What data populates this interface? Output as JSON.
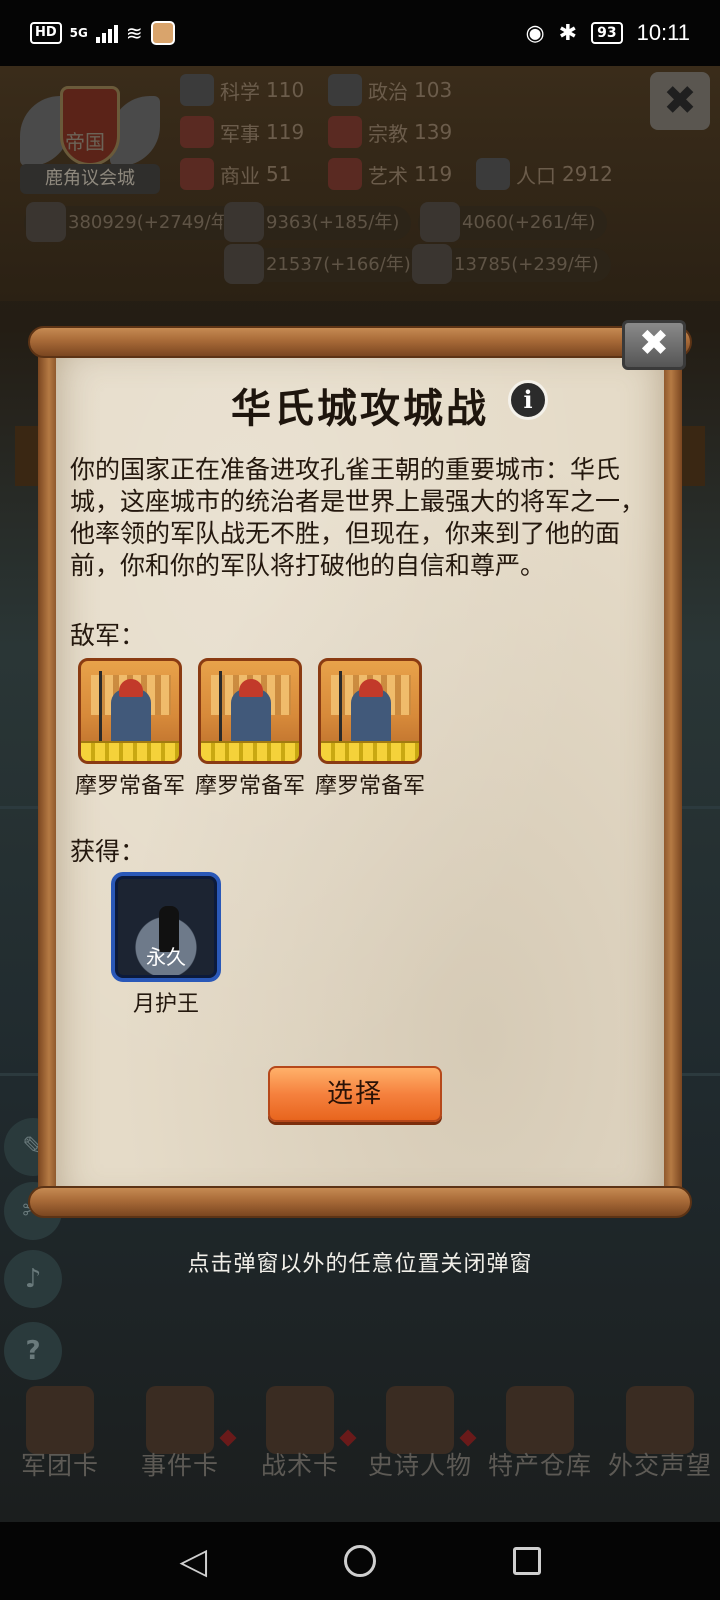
{
  "status_bar": {
    "hd": "HD",
    "network": "5G",
    "battery": "93",
    "time": "10:11"
  },
  "game_background": {
    "emblem": {
      "name": "帝国",
      "banner": "鹿角议会城"
    },
    "stats": [
      {
        "label": "科学",
        "value": "110",
        "icon": "planet-icon"
      },
      {
        "label": "政治",
        "value": "103",
        "icon": "capitol-icon"
      },
      {
        "label": "军事",
        "value": "119",
        "icon": "crossed-swords-icon"
      },
      {
        "label": "宗教",
        "value": "139",
        "icon": "fleur-icon"
      },
      {
        "label": "商业",
        "value": "51",
        "icon": "scales-icon"
      },
      {
        "label": "艺术",
        "value": "119",
        "icon": "lotus-icon"
      },
      {
        "label": "人口",
        "value": "2912",
        "icon": "person-icon"
      }
    ],
    "resources": [
      {
        "value": "380929(+2749/年)",
        "icon": "gold-coins-icon"
      },
      {
        "value": "9363(+185/年)",
        "icon": "wood-icon"
      },
      {
        "value": "4060(+261/年)",
        "icon": "iron-icon"
      },
      {
        "value": "21537(+166/年)",
        "icon": "stone-icon"
      },
      {
        "value": "13785(+239/年)",
        "icon": "meat-icon"
      }
    ],
    "close_label": "✖",
    "side_buttons": [
      "✎",
      "✂",
      "♪",
      "?"
    ],
    "bottom_nav": [
      {
        "label": "军团卡",
        "icon": "helmet-icon"
      },
      {
        "label": "事件卡",
        "icon": "scroll-icon"
      },
      {
        "label": "战术卡",
        "icon": "chess-icon"
      },
      {
        "label": "史诗人物",
        "icon": "crown-icon"
      },
      {
        "label": "特产仓库",
        "icon": "chest-icon"
      },
      {
        "label": "外交声望",
        "icon": "envelope-icon"
      }
    ]
  },
  "dialog": {
    "title": "华氏城攻城战",
    "info_glyph": "i",
    "close_glyph": "✖",
    "description": "你的国家正在准备进攻孔雀王朝的重要城市：华氏城，这座城市的统治者是世界上最强大的将军之一，他率领的军队战无不胜，但现在，你来到了他的面前，你和你的军队将打破他的自信和尊严。",
    "enemy_label": "敌军：",
    "enemies": [
      {
        "name": "摩罗常备军"
      },
      {
        "name": "摩罗常备军"
      },
      {
        "name": "摩罗常备军"
      }
    ],
    "reward_label": "获得：",
    "reward": {
      "name": "月护王",
      "tag": "永久"
    },
    "select_button": "选择"
  },
  "hint": "点击弹窗以外的任意位置关闭弹窗",
  "nav_bar": {
    "back": "◁"
  },
  "colors": {
    "parchment": "#e5dbc8",
    "scroll_wood": "#a86a38",
    "select_button": "#f5813e",
    "reward_border": "#2a58b8",
    "unit_border": "#8a3b12"
  }
}
